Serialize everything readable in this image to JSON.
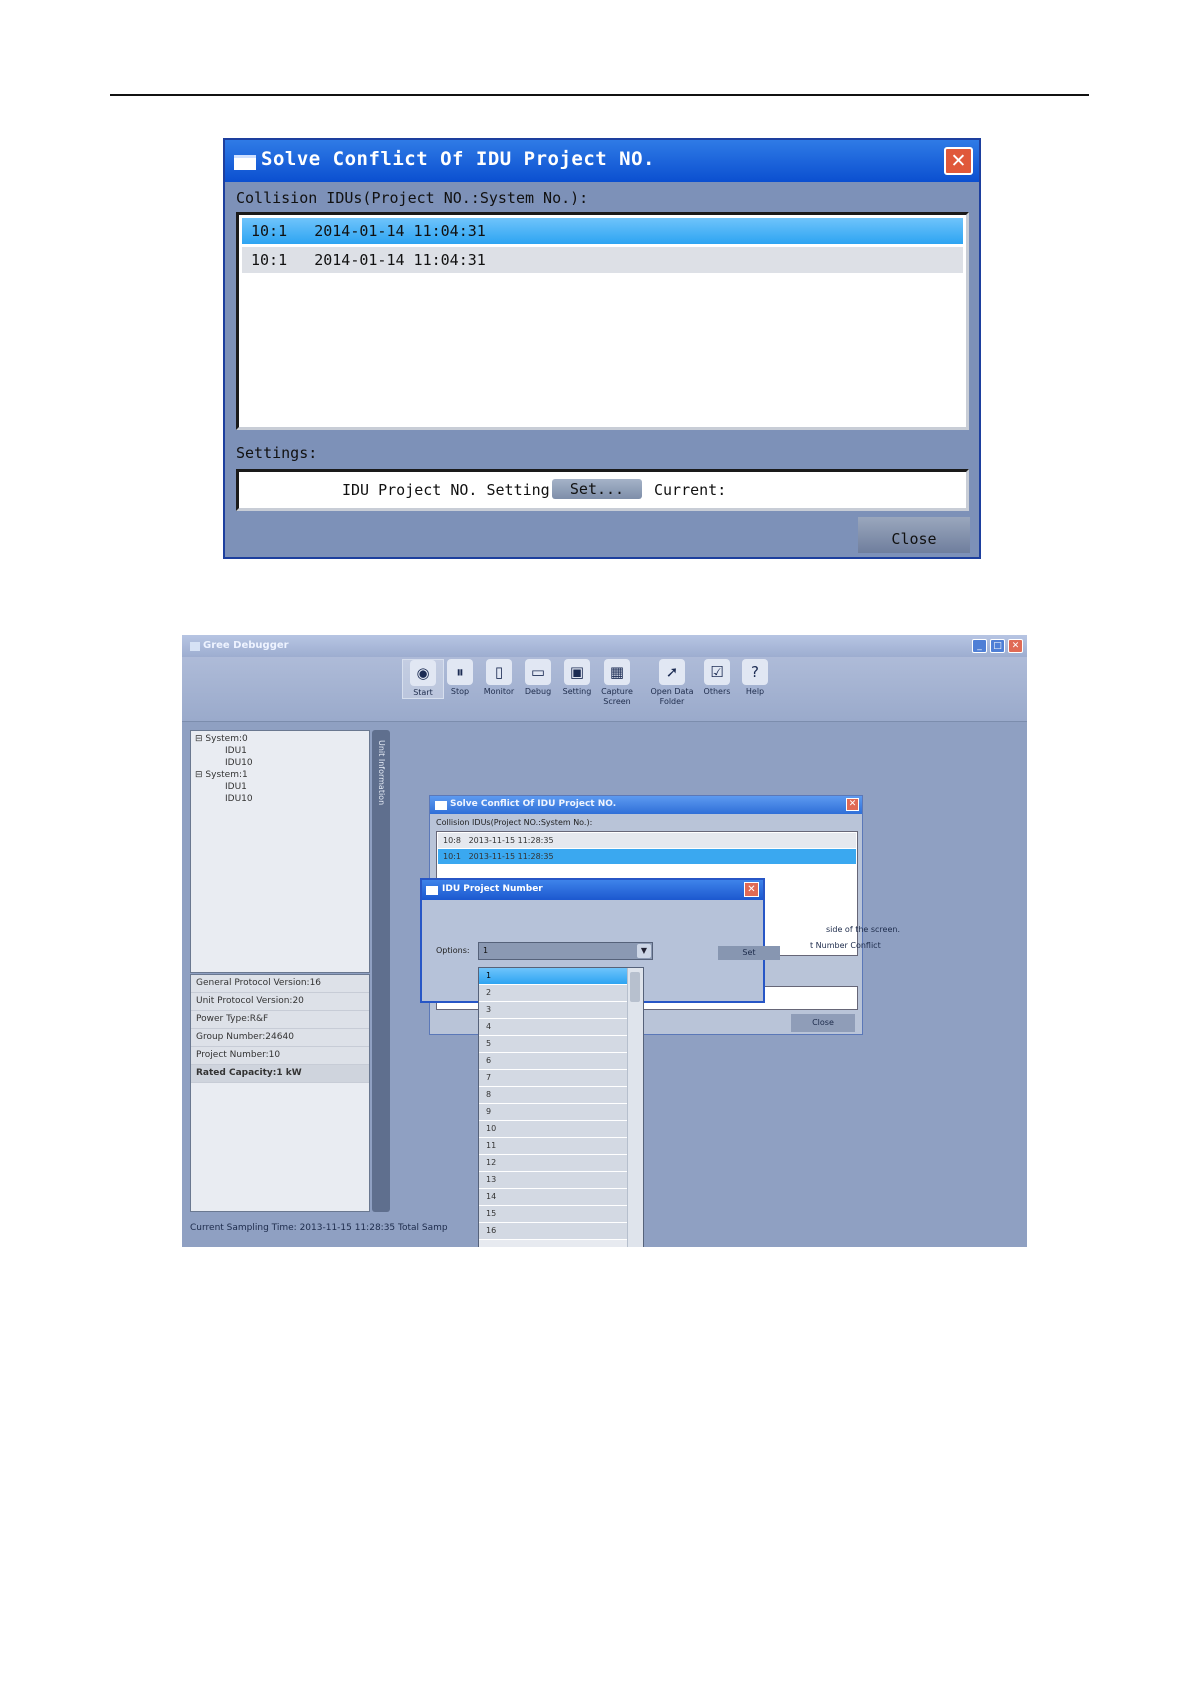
{
  "dialog1": {
    "title": "Solve Conflict Of IDU Project NO.",
    "close_glyph": "✕",
    "collision_label": "Collision IDUs(Project NO.:System No.):",
    "rows": [
      {
        "text": "10:1   2014-01-14 11:04:31",
        "selected": true
      },
      {
        "text": "10:1   2014-01-14 11:04:31",
        "selected": false
      }
    ],
    "settings_label": "Settings:",
    "setting_text": "IDU Project NO. Setting:",
    "set_button": "Set...",
    "current_label": "Current:",
    "close_button": "Close"
  },
  "screenshot2": {
    "app_title": "Gree Debugger",
    "window_buttons": [
      "_",
      "□",
      "✕"
    ],
    "toolbar": [
      {
        "label": "Start",
        "icon": "start-icon",
        "glyph": "◉",
        "active": true
      },
      {
        "label": "Stop",
        "icon": "stop-icon",
        "glyph": "⏸",
        "active": false
      },
      {
        "label": "Monitor",
        "icon": "monitor-icon",
        "glyph": "▯",
        "active": false
      },
      {
        "label": "Debug",
        "icon": "debug-icon",
        "glyph": "▭",
        "active": false
      },
      {
        "label": "Setting",
        "icon": "setting-icon",
        "glyph": "▣",
        "active": false
      },
      {
        "label": "Capture Screen",
        "icon": "capture-screen-icon",
        "glyph": "▦",
        "active": false
      },
      {
        "label": "Open Data Folder",
        "icon": "folder-icon",
        "glyph": "➚",
        "active": false
      },
      {
        "label": "Others",
        "icon": "others-icon",
        "glyph": "☑",
        "active": false
      },
      {
        "label": "Help",
        "icon": "help-icon",
        "glyph": "?",
        "active": false
      }
    ],
    "tree": [
      "⊟ System:0",
      "IDU1",
      "IDU10",
      "⊟ System:1",
      "IDU1",
      "IDU10"
    ],
    "side_tab": "Unit Information",
    "info_rows": [
      "General Protocol Version:16",
      "Unit Protocol Version:20",
      "Power Type:R&F",
      "Group Number:24640",
      "Project Number:10",
      "Rated Capacity:1 kW"
    ],
    "status_text": "Current Sampling Time: 2013-11-15 11:28:35   Total Samp",
    "conflict_dialog": {
      "title": "Solve Conflict Of IDU Project NO.",
      "label": "Collision IDUs(Project NO.:System No.):",
      "rows": [
        "10:8   2013-11-15 11:28:35",
        "10:1   2013-11-15 11:28:35"
      ],
      "close": "Close"
    },
    "side_text_1": "side of the screen.",
    "side_text_2": "t Number Conflict",
    "project_dialog": {
      "title": "IDU Project Number",
      "options_label": "Options:",
      "selected": "1",
      "set_button": "Set"
    },
    "dropdown_options": [
      "1",
      "2",
      "3",
      "4",
      "5",
      "6",
      "7",
      "8",
      "9",
      "10",
      "11",
      "12",
      "13",
      "14",
      "15",
      "16"
    ]
  }
}
